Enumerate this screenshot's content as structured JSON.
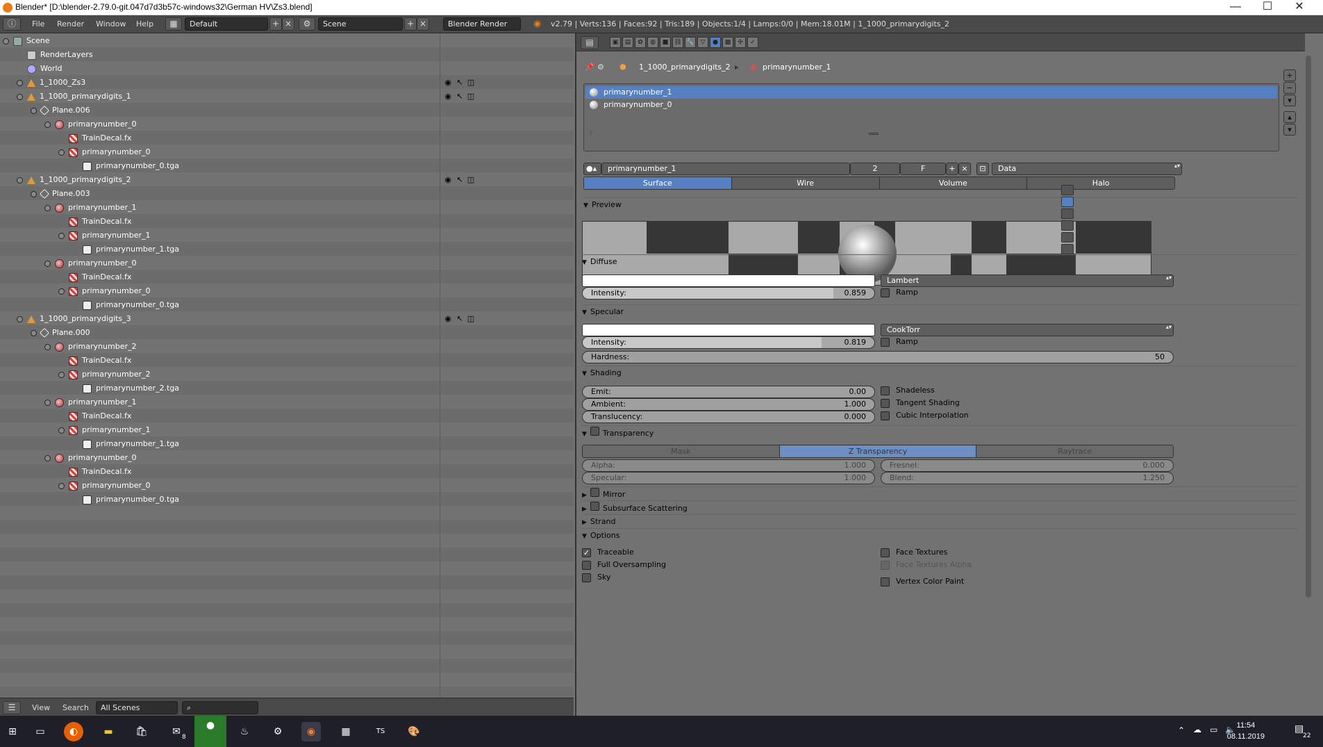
{
  "window": {
    "title": "Blender* [D:\\blender-2.79.0-git.047d7d3b57c-windows32\\German HV\\Zs3.blend]",
    "min": "—",
    "max": "☐",
    "close": "✕"
  },
  "topbar": {
    "menus": [
      "File",
      "Render",
      "Window",
      "Help"
    ],
    "layout": "Default",
    "scene": "Scene",
    "engine": "Blender Render",
    "stats": "v2.79 | Verts:136 | Faces:92 | Tris:189 | Objects:1/4 | Lamps:0/0 | Mem:18.01M | 1_1000_primarydigits_2"
  },
  "outliner": {
    "rows": [
      {
        "label": "Scene",
        "icon": "scene-icon",
        "depth": 0
      },
      {
        "label": "RenderLayers",
        "icon": "renderlayers-icon",
        "depth": 1
      },
      {
        "label": "World",
        "icon": "world-icon",
        "depth": 1
      },
      {
        "label": "1_1000_Zs3",
        "icon": "object-icon",
        "depth": 1
      },
      {
        "label": "1_1000_primarydigits_1",
        "icon": "object-icon",
        "depth": 1
      },
      {
        "label": "Plane.006",
        "icon": "mesh-icon",
        "depth": 2
      },
      {
        "label": "primarynumber_0",
        "icon": "material-icon",
        "depth": 3
      },
      {
        "label": "TrainDecal.fx",
        "icon": "texture-icon",
        "depth": 4
      },
      {
        "label": "primarynumber_0",
        "icon": "texture-icon",
        "depth": 4
      },
      {
        "label": "primarynumber_0.tga",
        "icon": "image-icon",
        "depth": 5
      },
      {
        "label": "1_1000_primarydigits_2",
        "icon": "object-icon",
        "depth": 1
      },
      {
        "label": "Plane.003",
        "icon": "mesh-icon",
        "depth": 2
      },
      {
        "label": "primarynumber_1",
        "icon": "material-icon",
        "depth": 3
      },
      {
        "label": "TrainDecal.fx",
        "icon": "texture-icon",
        "depth": 4
      },
      {
        "label": "primarynumber_1",
        "icon": "texture-icon",
        "depth": 4
      },
      {
        "label": "primarynumber_1.tga",
        "icon": "image-icon",
        "depth": 5
      },
      {
        "label": "primarynumber_0",
        "icon": "material-icon",
        "depth": 3
      },
      {
        "label": "TrainDecal.fx",
        "icon": "texture-icon",
        "depth": 4
      },
      {
        "label": "primarynumber_0",
        "icon": "texture-icon",
        "depth": 4
      },
      {
        "label": "primarynumber_0.tga",
        "icon": "image-icon",
        "depth": 5
      },
      {
        "label": "1_1000_primarydigits_3",
        "icon": "object-icon",
        "depth": 1
      },
      {
        "label": "Plane.000",
        "icon": "mesh-icon",
        "depth": 2
      },
      {
        "label": "primarynumber_2",
        "icon": "material-icon",
        "depth": 3
      },
      {
        "label": "TrainDecal.fx",
        "icon": "texture-icon",
        "depth": 4
      },
      {
        "label": "primarynumber_2",
        "icon": "texture-icon",
        "depth": 4
      },
      {
        "label": "primarynumber_2.tga",
        "icon": "image-icon",
        "depth": 5
      },
      {
        "label": "primarynumber_1",
        "icon": "material-icon",
        "depth": 3
      },
      {
        "label": "TrainDecal.fx",
        "icon": "texture-icon",
        "depth": 4
      },
      {
        "label": "primarynumber_1",
        "icon": "texture-icon",
        "depth": 4
      },
      {
        "label": "primarynumber_1.tga",
        "icon": "image-icon",
        "depth": 5
      },
      {
        "label": "primarynumber_0",
        "icon": "material-icon",
        "depth": 3
      },
      {
        "label": "TrainDecal.fx",
        "icon": "texture-icon",
        "depth": 4
      },
      {
        "label": "primarynumber_0",
        "icon": "texture-icon",
        "depth": 4
      },
      {
        "label": "primarynumber_0.tga",
        "icon": "image-icon",
        "depth": 5
      }
    ],
    "footer": {
      "view": "View",
      "search": "Search",
      "scenes": "All Scenes"
    }
  },
  "props": {
    "breadcrumb": {
      "object": "1_1000_primarydigits_2",
      "material": "primarynumber_1"
    },
    "slots": [
      {
        "label": "primarynumber_1",
        "selected": true
      },
      {
        "label": "primarynumber_0",
        "selected": false
      }
    ],
    "material_name": "primarynumber_1",
    "users": "2",
    "fake": "F",
    "link": "Data",
    "tabs": [
      {
        "label": "Surface",
        "active": true
      },
      {
        "label": "Wire",
        "active": false
      },
      {
        "label": "Volume",
        "active": false
      },
      {
        "label": "Halo",
        "active": false
      }
    ],
    "preview": {
      "header": "Preview"
    },
    "diffuse": {
      "header": "Diffuse",
      "shader": "Lambert",
      "intensity_label": "Intensity:",
      "intensity": "0.859",
      "intensity_frac": 0.859,
      "ramp": "Ramp"
    },
    "specular": {
      "header": "Specular",
      "shader": "CookTorr",
      "intensity_label": "Intensity:",
      "intensity": "0.819",
      "intensity_frac": 0.819,
      "ramp": "Ramp",
      "hardness_label": "Hardness:",
      "hardness": "50"
    },
    "shading": {
      "header": "Shading",
      "emit_label": "Emit:",
      "emit": "0.00",
      "ambient_label": "Ambient:",
      "ambient": "1.000",
      "translucency_label": "Translucency:",
      "translucency": "0.000",
      "shadeless": "Shadeless",
      "tangent": "Tangent Shading",
      "cubic": "Cubic Interpolation"
    },
    "transparency": {
      "header": "Transparency",
      "modes": [
        {
          "label": "Mask",
          "active": false
        },
        {
          "label": "Z Transparency",
          "active": true
        },
        {
          "label": "Raytrace",
          "active": false
        }
      ],
      "alpha_label": "Alpha:",
      "alpha": "1.000",
      "specular_label": "Specular:",
      "specular": "1.000",
      "fresnel_label": "Fresnel:",
      "fresnel": "0.000",
      "blend_label": "Blend:",
      "blend": "1.250"
    },
    "collapsed": {
      "mirror": "Mirror",
      "sss": "Subsurface Scattering",
      "strand": "Strand"
    },
    "options": {
      "header": "Options",
      "traceable": "Traceable",
      "full_os": "Full Oversampling",
      "sky": "Sky",
      "face_tex": "Face Textures",
      "face_tex_alpha": "Face Textures Alpha",
      "vcol_paint": "Vertex Color Paint"
    }
  },
  "taskbar": {
    "time": "11:54",
    "date": "08.11.2019",
    "mail_badge": "8",
    "notif": "22"
  }
}
